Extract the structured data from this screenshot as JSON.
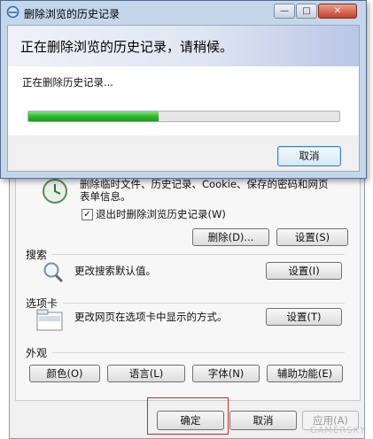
{
  "internet_options": {
    "history_desc_line1": "删除临时文件、历史记录、Cookie、保存的密码和网页",
    "history_desc_line2": "表单信息。",
    "delete_on_exit_label": "退出时删除浏览历史记录(W)",
    "delete_on_exit_checked": true,
    "delete_button": "删除(D)...",
    "history_settings_button": "设置(S)",
    "search": {
      "section_label": "搜索",
      "description": "更改搜索默认值。",
      "settings_button": "设置(I)"
    },
    "tabs": {
      "section_label": "选项卡",
      "description": "更改网页在选项卡中显示的方式。",
      "settings_button": "设置(T)"
    },
    "appearance": {
      "section_label": "外观",
      "colors_button": "颜色(O)",
      "languages_button": "语言(L)",
      "fonts_button": "字体(N)",
      "accessibility_button": "辅助功能(E)"
    },
    "footer": {
      "ok_button": "确定",
      "cancel_button": "取消",
      "apply_button": "应用(A)"
    }
  },
  "progress_dialog": {
    "window_title": "删除浏览的历史记录",
    "heading": "正在删除浏览的历史记录，请稍候。",
    "status": "正在删除历史记录...",
    "progress_fraction": 0.42,
    "cancel_button": "取消",
    "minimize_icon": "minimize-icon",
    "maximize_icon": "maximize-icon",
    "close_icon": "close-icon"
  },
  "watermark_text": "GAMERSKY",
  "colors": {
    "progress_fill": "#2bb52b",
    "highlight_box": "#d32626",
    "title_bar": "#c4d6ea"
  }
}
